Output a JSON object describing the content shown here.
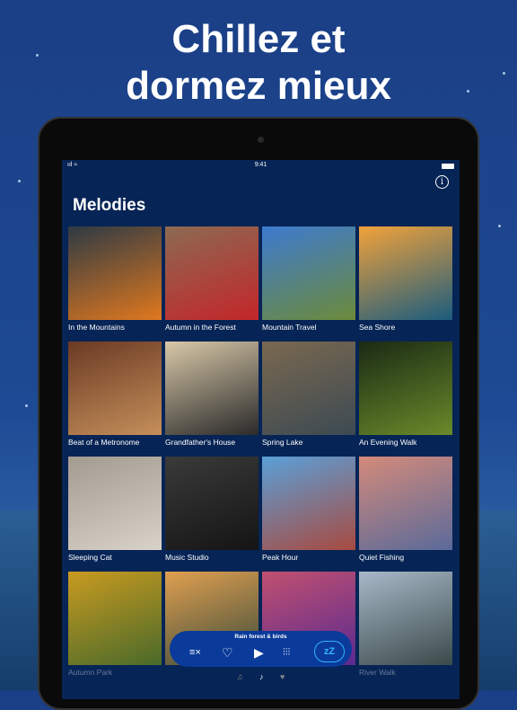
{
  "headline": {
    "line1": "Chillez et",
    "line2": "dormez mieux"
  },
  "status": {
    "signal": "ııl ≈",
    "time": "9:41"
  },
  "header": {
    "title": "Melodies",
    "info_icon": "info-icon"
  },
  "melodies": [
    {
      "label": "In the Mountains",
      "c1": "#2e3a44",
      "c2": "#e0781e"
    },
    {
      "label": "Autumn in the Forest",
      "c1": "#8c6a52",
      "c2": "#c4262a"
    },
    {
      "label": "Mountain Travel",
      "c1": "#3d7ad0",
      "c2": "#6c8b3a"
    },
    {
      "label": "Sea Shore",
      "c1": "#f2a23a",
      "c2": "#1b5c7e"
    },
    {
      "label": "Beat of a Metronome",
      "c1": "#6a3a24",
      "c2": "#c58f5a"
    },
    {
      "label": "Grandfather's House",
      "c1": "#d8c8a8",
      "c2": "#2a2a2a"
    },
    {
      "label": "Spring Lake",
      "c1": "#7a6850",
      "c2": "#3c4a52"
    },
    {
      "label": "An Evening Walk",
      "c1": "#1a2a14",
      "c2": "#6a8a2a"
    },
    {
      "label": "Sleeping Cat",
      "c1": "#a39a90",
      "c2": "#d9d2c8"
    },
    {
      "label": "Music Studio",
      "c1": "#3a3a3a",
      "c2": "#141414"
    },
    {
      "label": "Peak Hour",
      "c1": "#5aa0d8",
      "c2": "#a84a40"
    },
    {
      "label": "Quiet Fishing",
      "c1": "#d48a7a",
      "c2": "#5a6a9a"
    },
    {
      "label": "Autumn Park",
      "c1": "#c89a20",
      "c2": "#4a6a2a"
    },
    {
      "label": "",
      "c1": "#e0a050",
      "c2": "#3a4a3a"
    },
    {
      "label": "",
      "c1": "#c05070",
      "c2": "#5a2a90"
    },
    {
      "label": "River Walk",
      "c1": "#a8b8c8",
      "c2": "#3a4a4a"
    }
  ],
  "player": {
    "now_playing": "Rain forest & birds",
    "clear": "≡×",
    "favorite": "♡",
    "play": "▶",
    "mixer": "⫶⫶⫶",
    "sleep": "zZ"
  },
  "tabs": [
    {
      "icon": "♫"
    },
    {
      "icon": "♪"
    },
    {
      "icon": "♥"
    }
  ],
  "colors": {
    "screen_bg": "#062455",
    "player_bg": "#0a3a9a",
    "accent": "#30b5ff"
  }
}
